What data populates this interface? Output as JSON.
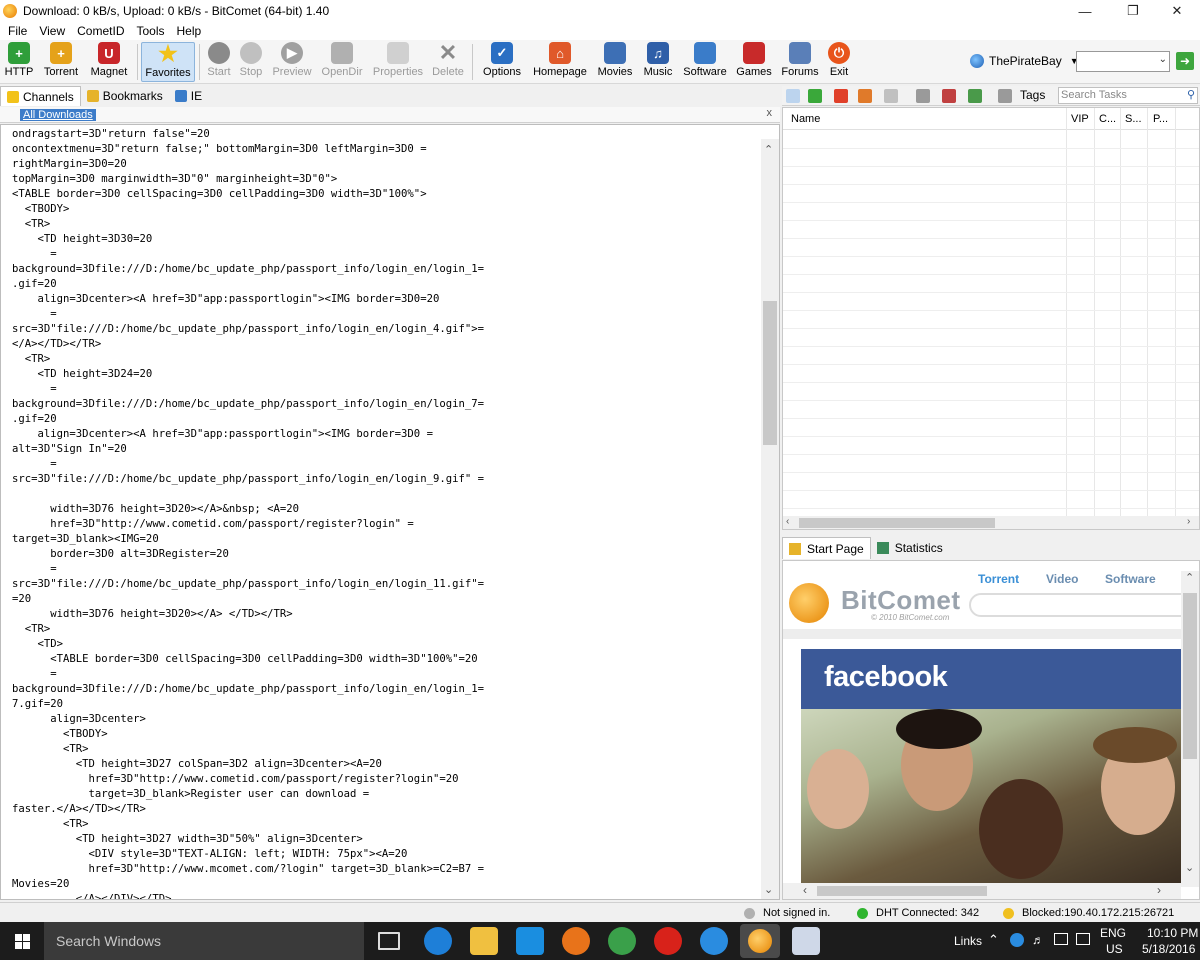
{
  "window": {
    "title": "Download: 0 kB/s, Upload: 0 kB/s - BitComet (64-bit) 1.40",
    "minimize_icon": "minimize-icon",
    "maximize_icon": "restore-icon",
    "close_icon": "close-icon"
  },
  "menu": [
    "File",
    "View",
    "CometID",
    "Tools",
    "Help"
  ],
  "toolbar": {
    "buttons": [
      {
        "label": "HTTP",
        "icon": "http-add-icon",
        "color": "#2f9e3a",
        "enabled": true
      },
      {
        "label": "Torrent",
        "icon": "torrent-add-icon",
        "color": "#e5a21a",
        "enabled": true
      },
      {
        "label": "Magnet",
        "icon": "magnet-icon",
        "color": "#c8262a",
        "enabled": true
      },
      {
        "label": "Favorites",
        "icon": "star-icon",
        "color": "#f2c21a",
        "enabled": true,
        "active": true
      },
      {
        "label": "Start",
        "icon": "start-icon",
        "color": "#8a8a8a",
        "enabled": false
      },
      {
        "label": "Stop",
        "icon": "stop-icon",
        "color": "#b0b0b0",
        "enabled": false
      },
      {
        "label": "Preview",
        "icon": "preview-icon",
        "color": "#a0a0a0",
        "enabled": false
      },
      {
        "label": "OpenDir",
        "icon": "folder-icon",
        "color": "#b0b0b0",
        "enabled": false
      },
      {
        "label": "Properties",
        "icon": "properties-icon",
        "color": "#bdbdbd",
        "enabled": false
      },
      {
        "label": "Delete",
        "icon": "delete-icon",
        "color": "#9a9a9a",
        "enabled": false
      },
      {
        "label": "Options",
        "icon": "options-icon",
        "color": "#2b6fc3",
        "enabled": true
      },
      {
        "label": "Homepage",
        "icon": "home-icon",
        "color": "#e0592a",
        "enabled": true
      },
      {
        "label": "Movies",
        "icon": "movies-icon",
        "color": "#3d6fb5",
        "enabled": true
      },
      {
        "label": "Music",
        "icon": "music-icon",
        "color": "#2f5fa8",
        "enabled": true
      },
      {
        "label": "Software",
        "icon": "software-icon",
        "color": "#3a7cc9",
        "enabled": true
      },
      {
        "label": "Games",
        "icon": "games-icon",
        "color": "#c82a2a",
        "enabled": true
      },
      {
        "label": "Forums",
        "icon": "forums-icon",
        "color": "#5a7fb8",
        "enabled": true
      },
      {
        "label": "Exit",
        "icon": "exit-icon",
        "color": "#e8541a",
        "enabled": true
      }
    ],
    "tracker_label": "ThePirateBay",
    "tracker_search_value": "",
    "go_icon": "go-arrow-icon"
  },
  "left_tabs": [
    {
      "label": "Channels",
      "icon": "star-icon",
      "active": true
    },
    {
      "label": "Bookmarks",
      "icon": "bookmarks-icon",
      "active": false
    },
    {
      "label": "IE",
      "icon": "ie-icon",
      "active": false
    }
  ],
  "address": {
    "link": "All Downloads",
    "close": "x"
  },
  "code_text": "ondragstart=3D\"return false\"=20\noncontextmenu=3D\"return false;\" bottomMargin=3D0 leftMargin=3D0 =\nrightMargin=3D0=20\ntopMargin=3D0 marginwidth=3D\"0\" marginheight=3D\"0\">\n<TABLE border=3D0 cellSpacing=3D0 cellPadding=3D0 width=3D\"100%\">\n  <TBODY>\n  <TR>\n    <TD height=3D30=20\n      =\nbackground=3Dfile:///D:/home/bc_update_php/passport_info/login_en/login_1=\n.gif=20\n    align=3Dcenter><A href=3D\"app:passportlogin\"><IMG border=3D0=20\n      =\nsrc=3D\"file:///D:/home/bc_update_php/passport_info/login_en/login_4.gif\">=\n</A></TD></TR>\n  <TR>\n    <TD height=3D24=20\n      =\nbackground=3Dfile:///D:/home/bc_update_php/passport_info/login_en/login_7=\n.gif=20\n    align=3Dcenter><A href=3D\"app:passportlogin\"><IMG border=3D0 =\nalt=3D\"Sign In\"=20\n      =\nsrc=3D\"file:///D:/home/bc_update_php/passport_info/login_en/login_9.gif\" =\n\n      width=3D76 height=3D20></A>&nbsp; <A=20\n      href=3D\"http://www.cometid.com/passport/register?login\" =\ntarget=3D_blank><IMG=20\n      border=3D0 alt=3DRegister=20\n      =\nsrc=3D\"file:///D:/home/bc_update_php/passport_info/login_en/login_11.gif\"=\n=20\n      width=3D76 height=3D20></A> </TD></TR>\n  <TR>\n    <TD>\n      <TABLE border=3D0 cellSpacing=3D0 cellPadding=3D0 width=3D\"100%\"=20\n      =\nbackground=3Dfile:///D:/home/bc_update_php/passport_info/login_en/login_1=\n7.gif=20\n      align=3Dcenter>\n        <TBODY>\n        <TR>\n          <TD height=3D27 colSpan=3D2 align=3Dcenter><A=20\n            href=3D\"http://www.cometid.com/passport/register?login\"=20\n            target=3D_blank>Register user can download =\nfaster.</A></TD></TR>\n        <TR>\n          <TD height=3D27 width=3D\"50%\" align=3Dcenter>\n            <DIV style=3D\"TEXT-ALIGN: left; WIDTH: 75px\"><A=20\n            href=3D\"http://www.mcomet.com/?login\" target=3D_blank>=C2=B7 =\nMovies=20\n          </A></DIV></TD>",
  "task_toolbar": {
    "tags_label": "Tags",
    "search_placeholder": "Search Tasks"
  },
  "task_columns": [
    "Name",
    "VIP",
    "C...",
    "S...",
    "P..."
  ],
  "bottom_tabs": [
    {
      "label": "Start Page",
      "icon": "start-page-icon",
      "active": true
    },
    {
      "label": "Statistics",
      "icon": "statistics-icon",
      "active": false
    }
  ],
  "start_page": {
    "nav": [
      "Torrent",
      "Video",
      "Software"
    ],
    "brand": "BitComet",
    "copyright": "© 2010 BitComet.com",
    "ad_brand": "facebook"
  },
  "status": {
    "signin": "Not signed in.",
    "dht": "DHT Connected: 342",
    "blocked": "Blocked:190.40.172.215:26721",
    "dht_color": "#2fb52f",
    "blocked_color": "#f0c020"
  },
  "taskbar": {
    "search_placeholder": "Search Windows",
    "links_label": "Links",
    "lang": "ENG",
    "region": "US",
    "time": "10:10 PM",
    "date": "5/18/2016"
  }
}
